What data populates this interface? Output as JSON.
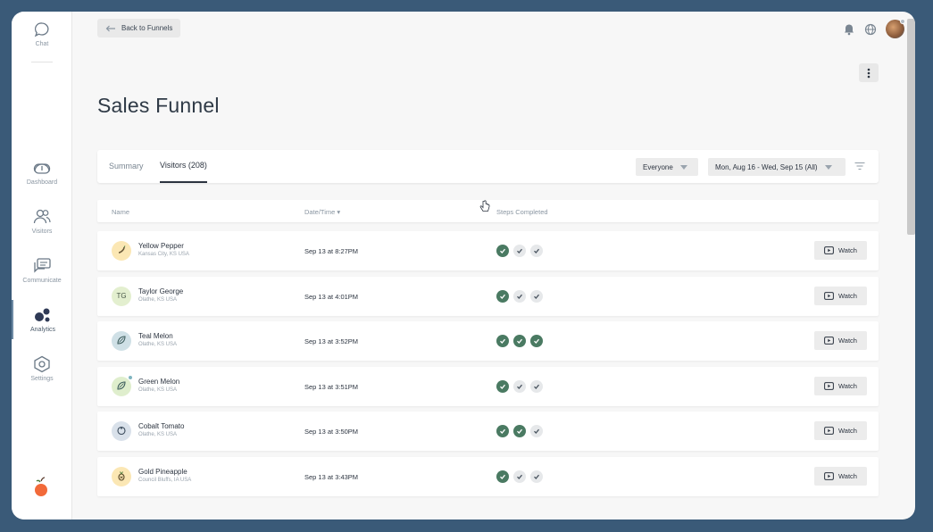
{
  "sidebar": {
    "chat": {
      "label": "Chat",
      "icon": "chat-bubble-icon"
    },
    "items": [
      {
        "label": "Dashboard",
        "icon": "dashboard-gauge-icon"
      },
      {
        "label": "Visitors",
        "icon": "users-icon"
      },
      {
        "label": "Communicate",
        "icon": "messages-icon"
      },
      {
        "label": "Analytics",
        "icon": "analytics-bubbles-icon",
        "active": true
      },
      {
        "label": "Settings",
        "icon": "settings-hexagon-icon"
      }
    ]
  },
  "header": {
    "back_label": "Back to Funnels",
    "title": "Sales Funnel"
  },
  "tabs": [
    {
      "label": "Summary",
      "active": false
    },
    {
      "label": "Visitors (208)",
      "active": true
    }
  ],
  "filters": {
    "audience": "Everyone",
    "date_range": "Mon, Aug 16 - Wed, Sep 15 (All)"
  },
  "table": {
    "columns": {
      "name": "Name",
      "date": "Date/Time ▾",
      "steps": "Steps Completed"
    },
    "watch_label": "Watch",
    "rows": [
      {
        "name": "Yellow Pepper",
        "location": "Kansas City, KS USA",
        "datetime": "Sep 13 at 8:27PM",
        "initials": "",
        "steps": [
          true,
          false,
          false
        ],
        "avatar_color": "#fbe7b4",
        "icon": "pepper-icon"
      },
      {
        "name": "Taylor George",
        "location": "Olathe, KS USA",
        "datetime": "Sep 13 at 4:01PM",
        "initials": "TG",
        "steps": [
          true,
          false,
          false
        ],
        "avatar_color": "#e3efcf",
        "icon": ""
      },
      {
        "name": "Teal Melon",
        "location": "Olathe, KS USA",
        "datetime": "Sep 13 at 3:52PM",
        "initials": "",
        "steps": [
          true,
          true,
          true
        ],
        "avatar_color": "#cfe0e6",
        "icon": "melon-icon"
      },
      {
        "name": "Green Melon",
        "location": "Olathe, KS USA",
        "datetime": "Sep 13 at 3:51PM",
        "initials": "",
        "steps": [
          true,
          false,
          false
        ],
        "avatar_color": "#dfeecd",
        "icon": "melon-icon",
        "online": true
      },
      {
        "name": "Cobalt Tomato",
        "location": "Olathe, KS USA",
        "datetime": "Sep 13 at 3:50PM",
        "initials": "",
        "steps": [
          true,
          true,
          false
        ],
        "avatar_color": "#d9e1ea",
        "icon": "tomato-icon"
      },
      {
        "name": "Gold Pineapple",
        "location": "Council Bluffs, IA USA",
        "datetime": "Sep 13 at 3:43PM",
        "initials": "",
        "steps": [
          true,
          false,
          false
        ],
        "avatar_color": "#fbe7b4",
        "icon": "pineapple-icon"
      }
    ]
  },
  "colors": {
    "step_done": "#4a7a62",
    "background": "#3a5a78"
  }
}
